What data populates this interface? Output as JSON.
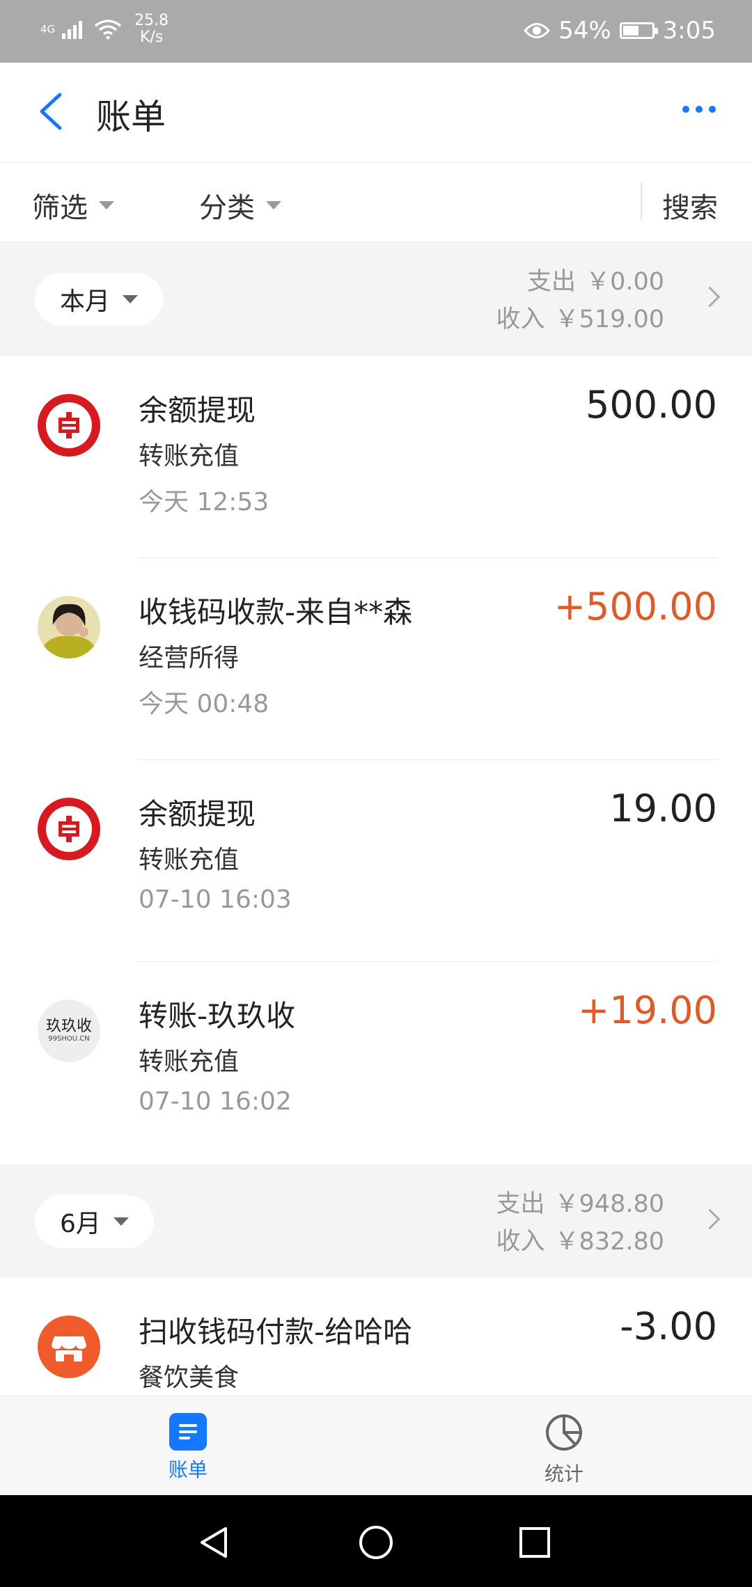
{
  "status_bar": {
    "network": "4G",
    "speed_value": "25.8",
    "speed_unit": "K/s",
    "battery": "54%",
    "battery_level": 0.54,
    "time": "3:05"
  },
  "header": {
    "title": "账单"
  },
  "filters": {
    "filter_label": "筛选",
    "category_label": "分类",
    "search_label": "搜索"
  },
  "months": [
    {
      "label": "本月",
      "expense_label": "支出",
      "expense_value": "￥0.00",
      "income_label": "收入",
      "income_value": "￥519.00",
      "transactions": [
        {
          "name": "余额提现",
          "category": "转账充值",
          "time": "今天  12:53",
          "amount": "500.00",
          "icon": "icbc-bank-icon"
        },
        {
          "name": "收钱码收款-来自**森",
          "category": "经营所得",
          "time": "今天  00:48",
          "amount": "+500.00",
          "icon": "user-avatar"
        },
        {
          "name": "余额提现",
          "category": "转账充值",
          "time": "07-10  16:03",
          "amount": "19.00",
          "icon": "icbc-bank-icon"
        },
        {
          "name": "转账-玖玖收",
          "category": "转账充值",
          "time": "07-10  16:02",
          "amount": "+19.00",
          "icon": "jiujiushou-logo"
        }
      ]
    },
    {
      "label": "6月",
      "expense_label": "支出",
      "expense_value": "￥948.80",
      "income_label": "收入",
      "income_value": "￥832.80",
      "transactions": [
        {
          "name": "扫收钱码付款-给哈哈",
          "category": "餐饮美食",
          "amount": "-3.00",
          "icon": "shop-icon"
        }
      ]
    }
  ],
  "logos": {
    "jiujiushou_text": "玖玖收",
    "jiujiushou_url": "99SHOU.CN"
  },
  "bottom_nav": [
    {
      "label": "账单",
      "icon": "bill-icon",
      "active": true
    },
    {
      "label": "统计",
      "icon": "pie-chart-icon",
      "active": false
    }
  ],
  "colors": {
    "accent": "#1677ff",
    "positive_amount": "#e05a28",
    "icbc_red": "#d71920",
    "shop_orange": "#ef5b2b"
  }
}
